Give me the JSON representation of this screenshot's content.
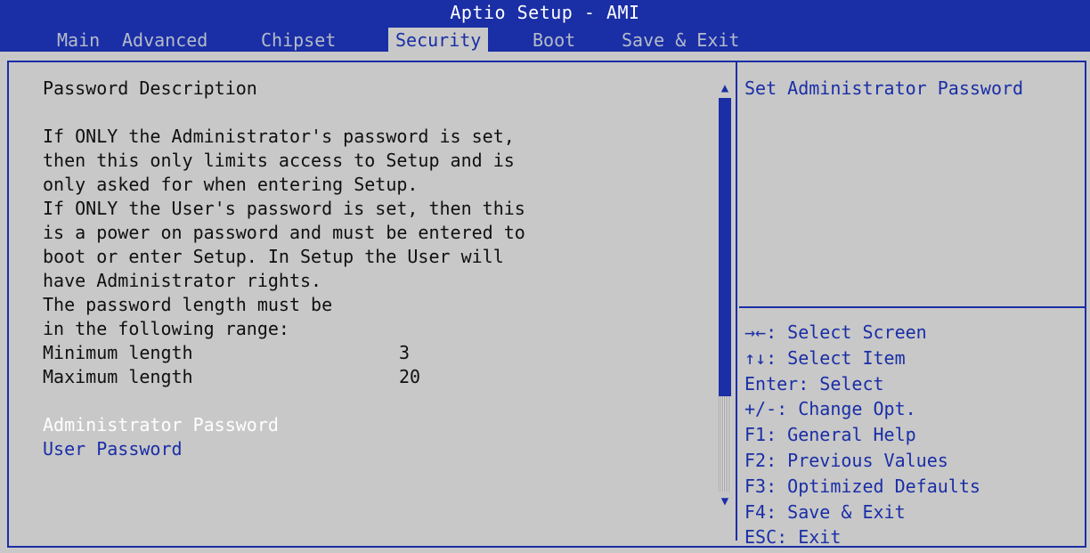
{
  "app": {
    "title": "Aptio Setup - AMI"
  },
  "tabs": [
    {
      "label": "Main",
      "active": false
    },
    {
      "label": "Advanced",
      "active": false
    },
    {
      "label": "Chipset",
      "active": false
    },
    {
      "label": "Security",
      "active": true
    },
    {
      "label": "Boot",
      "active": false
    },
    {
      "label": "Save & Exit",
      "active": false
    }
  ],
  "content": {
    "heading": "Password Description",
    "description": [
      "If ONLY the Administrator's password is set,",
      "then this only limits access to Setup and is",
      "only asked for when entering Setup.",
      "If ONLY the User's password is set, then this",
      "is a power on password and must be entered to",
      "boot or enter Setup. In Setup the User will",
      "have Administrator rights.",
      "The password length must be",
      "in the following range:"
    ],
    "min_length": {
      "label": "Minimum length",
      "value": "3"
    },
    "max_length": {
      "label": "Maximum length",
      "value": "20"
    },
    "items": [
      {
        "label": "Administrator Password",
        "selected": true
      },
      {
        "label": "User Password",
        "selected": false
      }
    ]
  },
  "help_text": "Set Administrator Password",
  "key_hints": [
    "→←: Select Screen",
    "↑↓: Select Item",
    "Enter: Select",
    "+/-: Change Opt.",
    "F1: General Help",
    "F2: Previous Values",
    "F3: Optimized Defaults",
    "F4: Save & Exit",
    "ESC: Exit"
  ],
  "colors": {
    "accent": "#1a2ea6",
    "panel_bg": "#c8c8c8",
    "inactive_tab": "#b4bcc8",
    "selected_item": "#ffffff"
  },
  "icons": {
    "scroll_up": "triangle-up-icon",
    "scroll_down": "triangle-down-icon"
  }
}
